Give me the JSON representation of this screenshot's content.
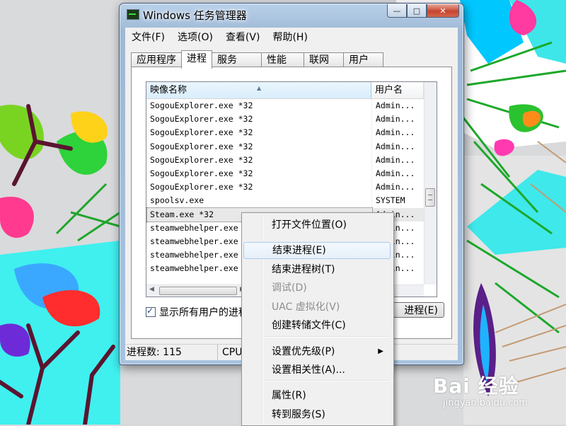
{
  "window": {
    "title": "Windows 任务管理器",
    "min_glyph": "—",
    "max_glyph": "□",
    "close_glyph": "✕"
  },
  "menu": [
    "文件(F)",
    "选项(O)",
    "查看(V)",
    "帮助(H)"
  ],
  "tabs": [
    {
      "label": "应用程序"
    },
    {
      "label": "进程",
      "active": true
    },
    {
      "label": "服务"
    },
    {
      "label": "性能"
    },
    {
      "label": "联网"
    },
    {
      "label": "用户"
    }
  ],
  "process_list": {
    "columns": [
      "映像名称",
      "用户名"
    ],
    "rows": [
      [
        "SogouExplorer.exe *32",
        "Admin..."
      ],
      [
        "SogouExplorer.exe *32",
        "Admin..."
      ],
      [
        "SogouExplorer.exe *32",
        "Admin..."
      ],
      [
        "SogouExplorer.exe *32",
        "Admin..."
      ],
      [
        "SogouExplorer.exe *32",
        "Admin..."
      ],
      [
        "SogouExplorer.exe *32",
        "Admin..."
      ],
      [
        "SogouExplorer.exe *32",
        "Admin..."
      ],
      [
        "spoolsv.exe",
        "SYSTEM"
      ],
      [
        "Steam.exe *32",
        "Admin..."
      ],
      [
        "steamwebhelper.exe",
        "Admin..."
      ],
      [
        "steamwebhelper.exe",
        "Admin..."
      ],
      [
        "steamwebhelper.exe",
        "Admin..."
      ],
      [
        "steamwebhelper.exe",
        "Admin..."
      ]
    ],
    "selected_row": "Steam.exe *32"
  },
  "show_all_users": {
    "label": "显示所有用户的进程",
    "checked": true
  },
  "end_process_button": "进程(E)",
  "status": {
    "processes": "进程数: 115",
    "cpu": "CPU"
  },
  "context_menu": [
    {
      "label": "打开文件位置(O)"
    },
    {
      "label": "结束进程(E)",
      "highlighted": true
    },
    {
      "label": "结束进程树(T)"
    },
    {
      "label": "调试(D)",
      "disabled": true
    },
    {
      "label": "UAC 虚拟化(V)",
      "disabled": true
    },
    {
      "label": "创建转储文件(C)"
    },
    {
      "label": "设置优先级(P)",
      "submenu": true
    },
    {
      "label": "设置相关性(A)..."
    },
    {
      "label": "属性(R)"
    },
    {
      "label": "转到服务(S)"
    }
  ],
  "watermark": {
    "main": "Bai 经验",
    "sub": "jingyan.baidu.com"
  },
  "colors": {
    "window_frame": "#a9c3df",
    "selection": "#e8e8e8",
    "menu_highlight": "#e7f0fa"
  }
}
